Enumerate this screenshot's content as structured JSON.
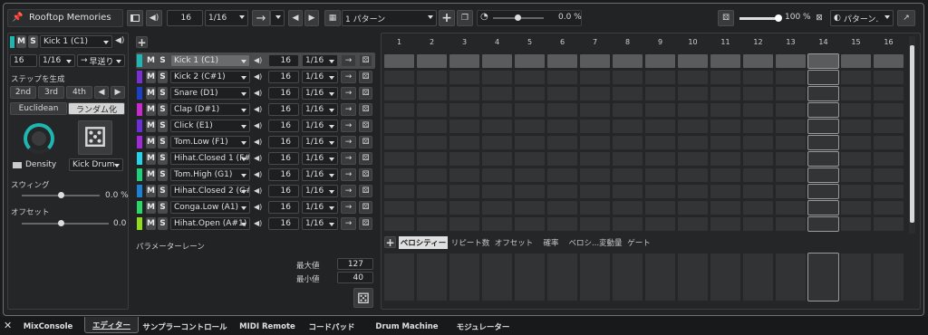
{
  "header": {
    "title": "Rooftop Memories",
    "steps": "16",
    "resolution": "1/16",
    "pattern": "1 パターン",
    "swing_value": "0.0 %",
    "volume": "100 %",
    "pattern_menu": "パターン."
  },
  "left": {
    "instrument": "Kick 1 (C1)",
    "steps": "16",
    "resolution": "1/16",
    "direction": "早送り",
    "generate_title": "ステップを生成",
    "gen_buttons": [
      "2nd",
      "3rd",
      "4th"
    ],
    "euclidean": "Euclidean",
    "randomize": "ランダム化",
    "density_label": "Density",
    "density_target": "Kick Drum",
    "swing_label": "スウィング",
    "swing_value": "0.0 %",
    "offset_label": "オフセット",
    "offset_value": "0.0"
  },
  "tracks": [
    {
      "name": "Kick 1 (C1)",
      "steps": "16",
      "res": "1/16",
      "color": "#1fb5b0"
    },
    {
      "name": "Kick 2 (C#1)",
      "steps": "16",
      "res": "1/16",
      "color": "#7c2fd0"
    },
    {
      "name": "Snare (D1)",
      "steps": "16",
      "res": "1/16",
      "color": "#1c3fc8"
    },
    {
      "name": "Clap (D#1)",
      "steps": "16",
      "res": "1/16",
      "color": "#c92ad0"
    },
    {
      "name": "Click (E1)",
      "steps": "16",
      "res": "1/16",
      "color": "#6a2fd8"
    },
    {
      "name": "Tom.Low (F1)",
      "steps": "16",
      "res": "1/16",
      "color": "#a02ad8"
    },
    {
      "name": "Hihat.Closed 1 (F#.",
      "steps": "16",
      "res": "1/16",
      "color": "#25d4e8"
    },
    {
      "name": "Tom.High (G1)",
      "steps": "16",
      "res": "1/16",
      "color": "#1fd07a"
    },
    {
      "name": "Hihat.Closed 2 (G#.",
      "steps": "16",
      "res": "1/16",
      "color": "#1f7fd0"
    },
    {
      "name": "Conga.Low (A1)",
      "steps": "16",
      "res": "1/16",
      "color": "#28d868"
    },
    {
      "name": "Hihat.Open (A#1)",
      "steps": "16",
      "res": "1/16",
      "color": "#8fdc1c"
    }
  ],
  "columns": [
    "1",
    "2",
    "3",
    "4",
    "5",
    "6",
    "7",
    "8",
    "9",
    "10",
    "11",
    "12",
    "13",
    "14",
    "15",
    "16"
  ],
  "params": {
    "title": "パラメーターレーン",
    "max_label": "最大値",
    "max_value": "127",
    "min_label": "最小値",
    "min_value": "40",
    "tabs": [
      "ベロシティー",
      "リピート数",
      "オフセット",
      "確率",
      "ベロシ...変動量",
      "ゲート"
    ]
  },
  "bottom_tabs": [
    "MixConsole",
    "エディター",
    "サンプラーコントロール",
    "MIDI Remote",
    "コードパッド",
    "Drum Machine",
    "モジュレーター"
  ],
  "colors": {
    "accent": "#2aa198",
    "active_tab": "#ffffff"
  }
}
